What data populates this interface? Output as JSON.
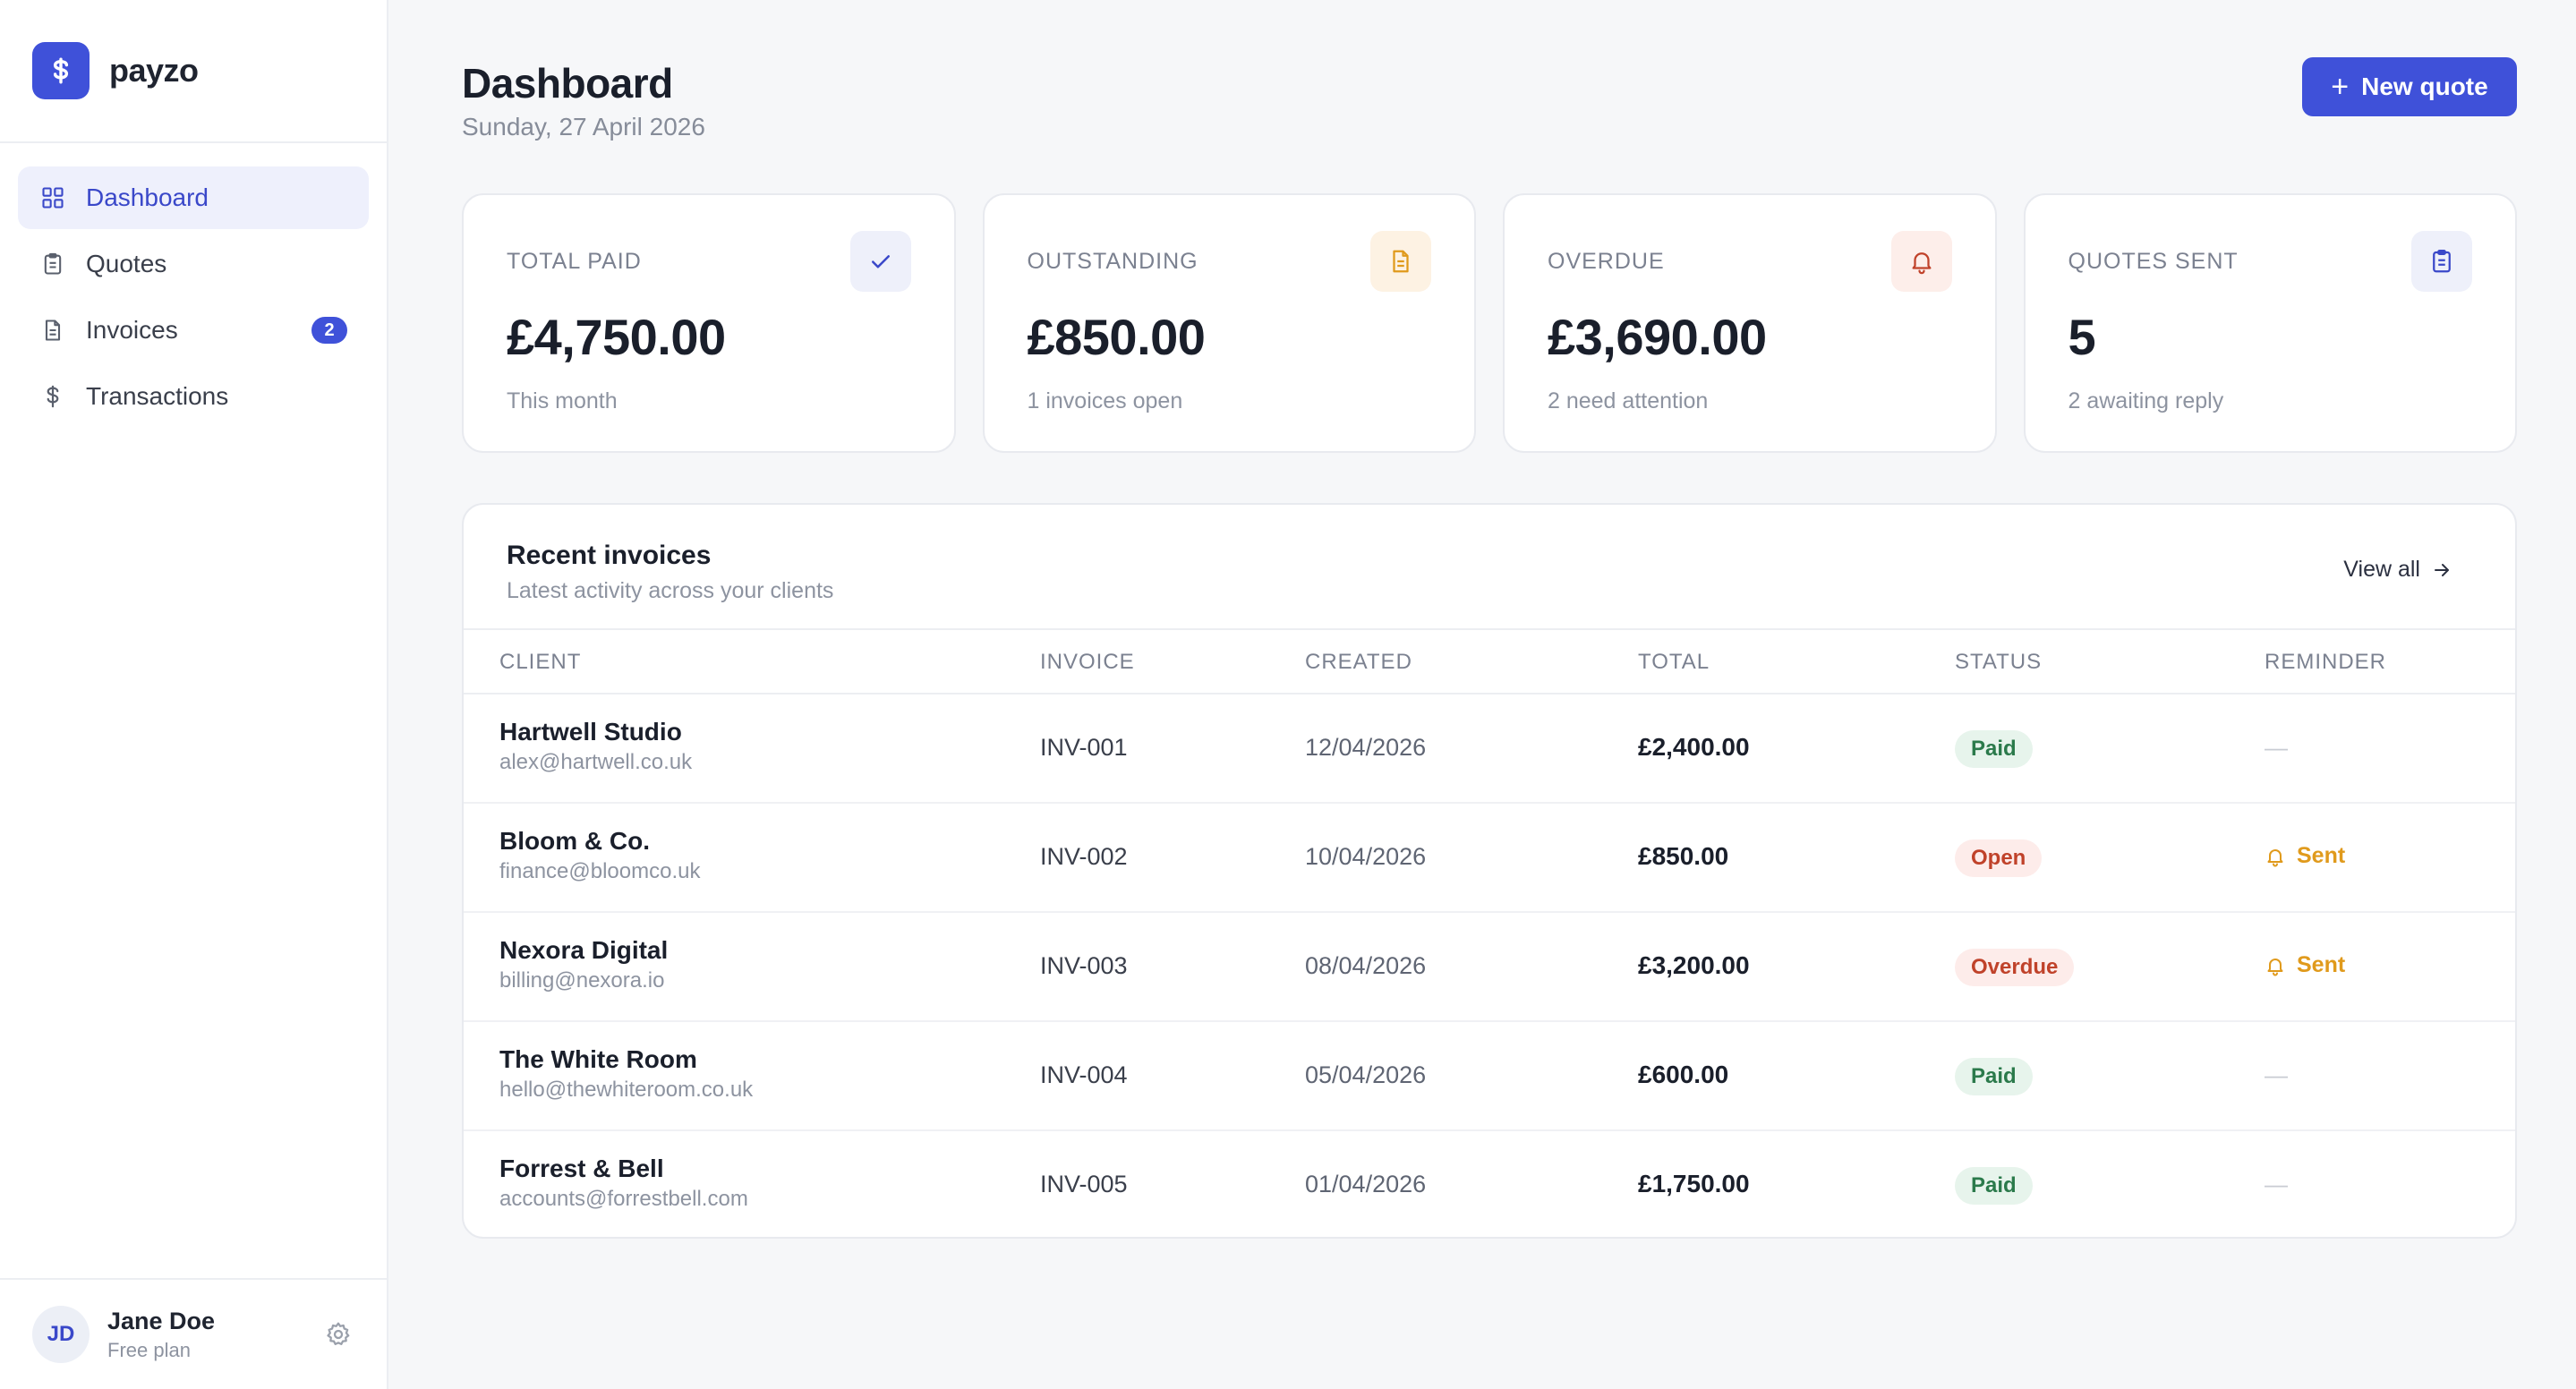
{
  "brand": {
    "name": "payzo",
    "logo_icon": "dollar-icon",
    "color": "#3f51d9"
  },
  "sidebar": {
    "items": [
      {
        "label": "Dashboard",
        "icon": "grid-icon",
        "active": true
      },
      {
        "label": "Quotes",
        "icon": "clipboard-icon"
      },
      {
        "label": "Invoices",
        "icon": "document-icon",
        "badge": "2"
      },
      {
        "label": "Transactions",
        "icon": "dollar-icon"
      }
    ]
  },
  "user": {
    "initials": "JD",
    "name": "Jane Doe",
    "plan": "Free plan"
  },
  "header": {
    "title": "Dashboard",
    "date": "Sunday, 27 April 2026",
    "new_quote_label": "New quote"
  },
  "stats": [
    {
      "label": "TOTAL PAID",
      "value": "£4,750.00",
      "sub": "This month",
      "icon": "check-icon"
    },
    {
      "label": "OUTSTANDING",
      "value": "£850.00",
      "sub": "1 invoices open",
      "icon": "document-icon"
    },
    {
      "label": "OVERDUE",
      "value": "£3,690.00",
      "sub": "2 need attention",
      "icon": "bell-icon"
    },
    {
      "label": "QUOTES SENT",
      "value": "5",
      "sub": "2 awaiting reply",
      "icon": "clipboard-icon"
    }
  ],
  "recent": {
    "title": "Recent invoices",
    "subtitle": "Latest activity across your clients",
    "view_all": "View all",
    "columns": [
      "CLIENT",
      "INVOICE",
      "CREATED",
      "TOTAL",
      "STATUS",
      "REMINDER"
    ],
    "rows": [
      {
        "client": "Hartwell Studio",
        "email": "alex@hartwell.co.uk",
        "invoice": "INV-001",
        "created": "12/04/2026",
        "total": "£2,400.00",
        "status": "Paid",
        "reminder": "—"
      },
      {
        "client": "Bloom & Co.",
        "email": "finance@bloomco.uk",
        "invoice": "INV-002",
        "created": "10/04/2026",
        "total": "£850.00",
        "status": "Open",
        "reminder": "Sent"
      },
      {
        "client": "Nexora Digital",
        "email": "billing@nexora.io",
        "invoice": "INV-003",
        "created": "08/04/2026",
        "total": "£3,200.00",
        "status": "Overdue",
        "reminder": "Sent"
      },
      {
        "client": "The White Room",
        "email": "hello@thewhiteroom.co.uk",
        "invoice": "INV-004",
        "created": "05/04/2026",
        "total": "£600.00",
        "status": "Paid",
        "reminder": "—"
      },
      {
        "client": "Forrest & Bell",
        "email": "accounts@forrestbell.com",
        "invoice": "INV-005",
        "created": "01/04/2026",
        "total": "£1,750.00",
        "status": "Paid",
        "reminder": "—"
      }
    ]
  }
}
